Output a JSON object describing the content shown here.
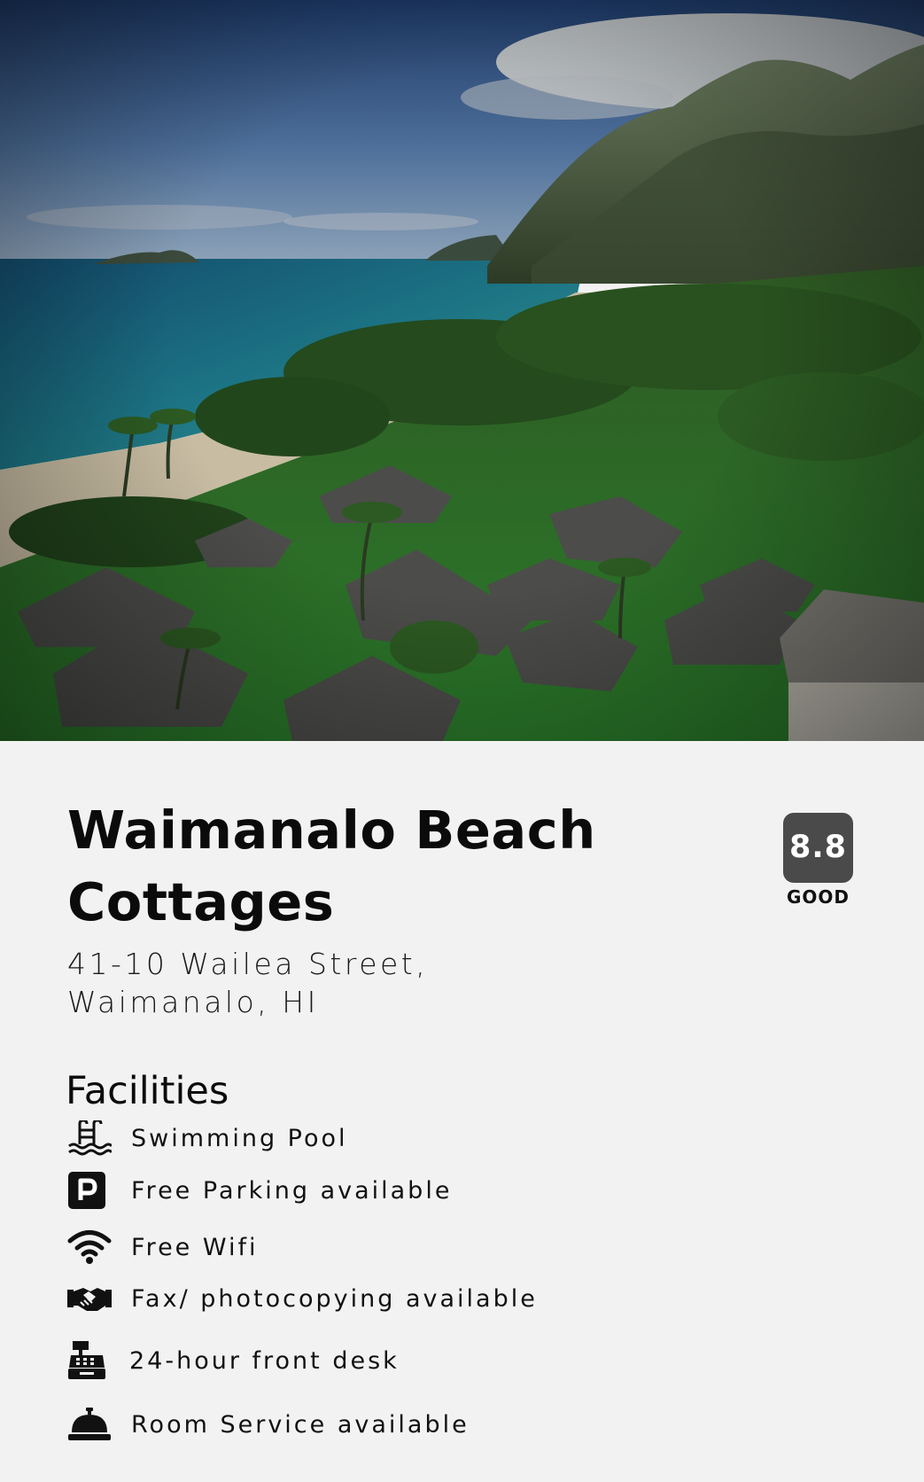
{
  "hotel": {
    "name": "Waimanalo Beach Cottages",
    "address_line1": "41-10 Wailea Street,",
    "address_line2": "Waimanalo, HI"
  },
  "rating": {
    "score": "8.8",
    "label": "GOOD"
  },
  "facilities": {
    "heading": "Facilities",
    "items": [
      {
        "icon": "swimming-pool-icon",
        "label": "Swimming Pool"
      },
      {
        "icon": "parking-icon",
        "label": "Free Parking available"
      },
      {
        "icon": "wifi-icon",
        "label": "Free Wifi"
      },
      {
        "icon": "handshake-icon",
        "label": "Fax/ photocopying available"
      },
      {
        "icon": "cash-register-icon",
        "label": "24-hour front desk"
      },
      {
        "icon": "service-bell-icon",
        "label": "Room Service available"
      }
    ]
  },
  "colors": {
    "background": "#f2f2f2",
    "rating_badge": "#4a4a4a",
    "text": "#111111"
  }
}
